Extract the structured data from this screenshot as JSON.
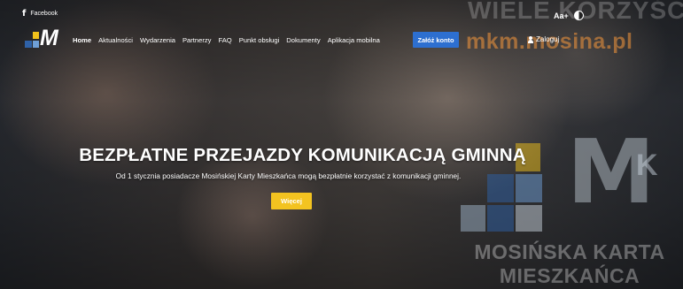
{
  "topbar": {
    "facebook_label": "Facebook",
    "watermark_text": "WIELE KORZYŚCI",
    "font_size_label": "Aa+"
  },
  "nav": {
    "items": [
      {
        "label": "Home",
        "active": true
      },
      {
        "label": "Aktualności"
      },
      {
        "label": "Wydarzenia"
      },
      {
        "label": "Partnerzy"
      },
      {
        "label": "FAQ"
      },
      {
        "label": "Punkt obsługi"
      },
      {
        "label": "Dokumenty"
      },
      {
        "label": "Aplikacja mobilna"
      }
    ],
    "register_label": "Załóż konto",
    "login_label": "Zaloguj",
    "watermark_url": "mkm.mosina.pl"
  },
  "hero": {
    "title": "BEZPŁATNE PRZEJAZDY KOMUNIKACJĄ GMINNĄ",
    "subtitle": "Od 1 stycznia posiadacze Mosińskiej Karty Mieszkańca mogą bezpłatnie korzystać z komunikacji gminnej.",
    "button_label": "Więcej"
  },
  "watermark_logo": {
    "line1": "MOSIŃSKA KARTA",
    "line2": "MIESZKAŃCA"
  },
  "colors": {
    "register_button": "#2d6fd0",
    "more_button": "#f3c320",
    "logo_blue": "#2f62a8",
    "logo_yellow": "#f2c21b"
  }
}
